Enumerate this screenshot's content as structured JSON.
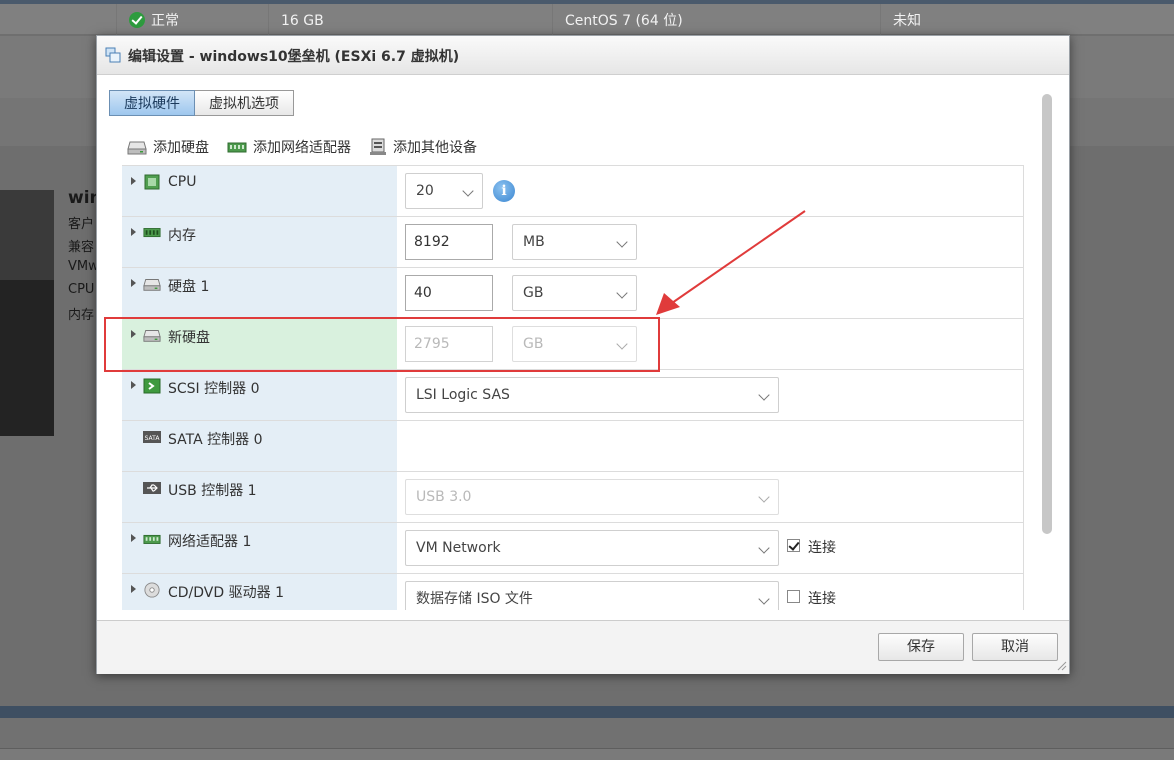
{
  "background": {
    "top_row": {
      "status": "正常",
      "memory": "16 GB",
      "os": "CentOS 7 (64 位)",
      "state": "未知"
    },
    "side_labels": [
      "win",
      "客户",
      "兼容",
      "VMw",
      "CPU",
      "内存"
    ]
  },
  "dialog": {
    "title": "编辑设置 - windows10堡垒机 (ESXi 6.7 虚拟机)",
    "tabs": [
      {
        "label": "虚拟硬件",
        "active": true
      },
      {
        "label": "虚拟机选项",
        "active": false
      }
    ],
    "toolbar": {
      "add_disk": "添加硬盘",
      "add_nic": "添加网络适配器",
      "add_other": "添加其他设备"
    },
    "rows": {
      "cpu": {
        "label": "CPU",
        "value": "20"
      },
      "memory": {
        "label": "内存",
        "value": "8192",
        "unit": "MB"
      },
      "disk1": {
        "label": "硬盘 1",
        "value": "40",
        "unit": "GB"
      },
      "newdisk": {
        "label": "新硬盘",
        "placeholder": "2795",
        "unit": "GB"
      },
      "scsi": {
        "label": "SCSI 控制器 0",
        "value": "LSI Logic SAS"
      },
      "sata": {
        "label": "SATA 控制器 0"
      },
      "usb": {
        "label": "USB 控制器 1",
        "value": "USB 3.0"
      },
      "nic": {
        "label": "网络适配器 1",
        "value": "VM Network",
        "connect_label": "连接",
        "connected": true
      },
      "cdrom": {
        "label": "CD/DVD 驱动器 1",
        "value": "数据存储 ISO 文件",
        "connect_label": "连接",
        "connected": false
      }
    },
    "buttons": {
      "save": "保存",
      "cancel": "取消"
    }
  },
  "colors": {
    "highlight_box": "#e03b3b",
    "active_tab": "#9ec7ee",
    "row_left": "#e4eef6",
    "row_highlight": "#d9f1de"
  }
}
